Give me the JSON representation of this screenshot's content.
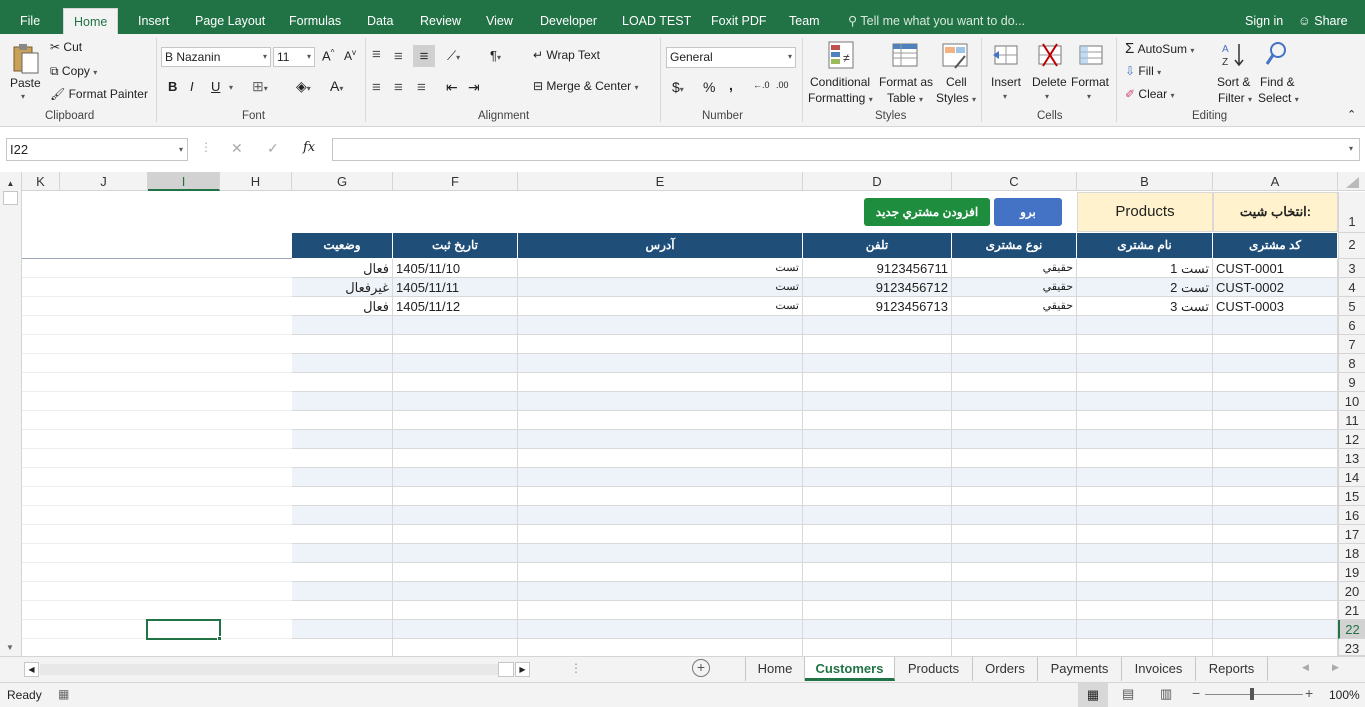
{
  "menu": {
    "tabs": [
      "File",
      "Home",
      "Insert",
      "Page Layout",
      "Formulas",
      "Data",
      "Review",
      "View",
      "Developer",
      "LOAD TEST",
      "Foxit PDF",
      "Team"
    ],
    "tell_me": "Tell me what you want to do...",
    "sign_in": "Sign in",
    "share": "Share"
  },
  "ribbon": {
    "clipboard": {
      "paste": "Paste",
      "cut": "Cut",
      "copy": "Copy",
      "format_painter": "Format Painter",
      "label": "Clipboard"
    },
    "font": {
      "name": "B Nazanin",
      "size": "11",
      "label": "Font",
      "bold": "B",
      "italic": "I",
      "underline": "U"
    },
    "alignment": {
      "wrap": "Wrap Text",
      "merge": "Merge & Center",
      "label": "Alignment"
    },
    "number": {
      "format": "General",
      "label": "Number",
      "currency": "$",
      "percent": "%",
      "comma": ","
    },
    "styles": {
      "conditional_1": "Conditional",
      "conditional_2": "Formatting",
      "format_table_1": "Format as",
      "format_table_2": "Table",
      "cell_styles_1": "Cell",
      "cell_styles_2": "Styles",
      "label": "Styles"
    },
    "cells": {
      "insert": "Insert",
      "delete": "Delete",
      "format": "Format",
      "label": "Cells"
    },
    "editing": {
      "autosum": "AutoSum",
      "fill": "Fill",
      "clear": "Clear",
      "sort_1": "Sort &",
      "sort_2": "Filter",
      "find_1": "Find &",
      "find_2": "Select",
      "label": "Editing"
    }
  },
  "formula_bar": {
    "name_box": "I22",
    "fx": "fx",
    "formula": ""
  },
  "columns": [
    "K",
    "J",
    "I",
    "H",
    "G",
    "F",
    "E",
    "D",
    "C",
    "B",
    "A"
  ],
  "row_numbers": [
    "1",
    "2",
    "3",
    "4",
    "5",
    "6",
    "7",
    "8",
    "9",
    "10",
    "11",
    "12",
    "13",
    "14",
    "15",
    "16",
    "17",
    "18",
    "19",
    "20",
    "21",
    "22",
    "23"
  ],
  "sheet": {
    "select_sheet_label": "انتخاب شیت:",
    "sheet_dropdown": "Products",
    "go_button": "برو",
    "add_button": "افزودن مشتري جديد",
    "headers": {
      "A": "کد مشتری",
      "B": "نام مشتری",
      "C": "نوع مشتری",
      "D": "تلفن",
      "E": "آدرس",
      "F": "تاریخ ثبت",
      "G": "وضعیت"
    },
    "rows": [
      {
        "A": "CUST-0001",
        "B": "تست 1",
        "C": "حقيقي",
        "D": "9123456711",
        "E": "تست",
        "F": "1405/11/10",
        "G": "فعال"
      },
      {
        "A": "CUST-0002",
        "B": "تست 2",
        "C": "حقيقي",
        "D": "9123456712",
        "E": "تست",
        "F": "1405/11/11",
        "G": "غيرفعال"
      },
      {
        "A": "CUST-0003",
        "B": "تست 3",
        "C": "حقيقي",
        "D": "9123456713",
        "E": "تست",
        "F": "1405/11/12",
        "G": "فعال"
      }
    ]
  },
  "sheet_tabs": [
    "Home",
    "Customers",
    "Products",
    "Orders",
    "Payments",
    "Invoices",
    "Reports"
  ],
  "active_tab": "Customers",
  "status": {
    "ready": "Ready",
    "zoom": "100%"
  },
  "colors": {
    "excel_green": "#217346",
    "header_blue": "#1f4e79",
    "add_green": "#1e8e3e",
    "go_blue": "#4472c4",
    "yellow": "#fff2cc"
  }
}
